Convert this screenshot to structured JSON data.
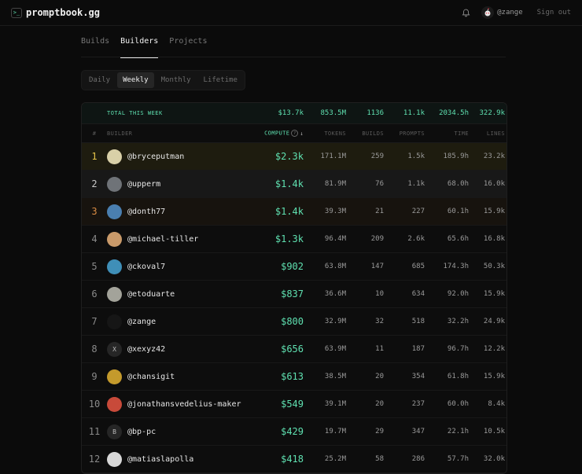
{
  "app": {
    "logo_glyph": ">_",
    "brand": "promptbook.gg",
    "username": "@zange",
    "sign_out": "Sign out"
  },
  "tabs": [
    {
      "label": "Builds",
      "active": false
    },
    {
      "label": "Builders",
      "active": true
    },
    {
      "label": "Projects",
      "active": false
    }
  ],
  "periods": [
    {
      "label": "Daily",
      "active": false
    },
    {
      "label": "Weekly",
      "active": true
    },
    {
      "label": "Monthly",
      "active": false
    },
    {
      "label": "Lifetime",
      "active": false
    }
  ],
  "totals": {
    "label": "TOTAL THIS WEEK",
    "compute": "$13.7k",
    "tokens": "853.5M",
    "builds": "1136",
    "prompts": "11.1k",
    "time": "2034.5h",
    "lines": "322.9k"
  },
  "columns": {
    "rank": "#",
    "builder": "BUILDER",
    "compute": "COMPUTE",
    "tokens": "TOKENS",
    "builds": "BUILDS",
    "prompts": "PROMPTS",
    "time": "TIME",
    "lines": "LINES",
    "sort_arrow": "↓"
  },
  "colors": {
    "accent": "#5fe0b0",
    "gold": "#e6c54a",
    "silver": "#c9c9c9",
    "bronze": "#d98c43"
  },
  "rows": [
    {
      "rank": "1",
      "handle": "@bryceputman",
      "compute": "$2.3k",
      "tokens": "171.1M",
      "builds": "259",
      "prompts": "1.5k",
      "time": "185.9h",
      "lines": "23.2k",
      "avatar": "",
      "avatar_color": "#d9d0a8"
    },
    {
      "rank": "2",
      "handle": "@upperm",
      "compute": "$1.4k",
      "tokens": "81.9M",
      "builds": "76",
      "prompts": "1.1k",
      "time": "68.0h",
      "lines": "16.0k",
      "avatar": "",
      "avatar_color": "#6f7378"
    },
    {
      "rank": "3",
      "handle": "@donth77",
      "compute": "$1.4k",
      "tokens": "39.3M",
      "builds": "21",
      "prompts": "227",
      "time": "60.1h",
      "lines": "15.9k",
      "avatar": "",
      "avatar_color": "#4a7fb0"
    },
    {
      "rank": "4",
      "handle": "@michael-tiller",
      "compute": "$1.3k",
      "tokens": "96.4M",
      "builds": "209",
      "prompts": "2.6k",
      "time": "65.6h",
      "lines": "16.8k",
      "avatar": "",
      "avatar_color": "#c99a6a"
    },
    {
      "rank": "5",
      "handle": "@ckoval7",
      "compute": "$902",
      "tokens": "63.8M",
      "builds": "147",
      "prompts": "685",
      "time": "174.3h",
      "lines": "50.3k",
      "avatar": "",
      "avatar_color": "#3f8fb8"
    },
    {
      "rank": "6",
      "handle": "@etoduarte",
      "compute": "$837",
      "tokens": "36.6M",
      "builds": "10",
      "prompts": "634",
      "time": "92.0h",
      "lines": "15.9k",
      "avatar": "",
      "avatar_color": "#a3a39a"
    },
    {
      "rank": "7",
      "handle": "@zange",
      "compute": "$800",
      "tokens": "32.9M",
      "builds": "32",
      "prompts": "518",
      "time": "32.2h",
      "lines": "24.9k",
      "avatar": "",
      "avatar_color": "#161616"
    },
    {
      "rank": "8",
      "handle": "@xexyz42",
      "compute": "$656",
      "tokens": "63.9M",
      "builds": "11",
      "prompts": "187",
      "time": "96.7h",
      "lines": "12.2k",
      "avatar": "X",
      "avatar_color": "#262626"
    },
    {
      "rank": "9",
      "handle": "@chansigit",
      "compute": "$613",
      "tokens": "38.5M",
      "builds": "20",
      "prompts": "354",
      "time": "61.8h",
      "lines": "15.9k",
      "avatar": "",
      "avatar_color": "#c49a2c"
    },
    {
      "rank": "10",
      "handle": "@jonathansvedelius-maker",
      "compute": "$549",
      "tokens": "39.1M",
      "builds": "20",
      "prompts": "237",
      "time": "60.0h",
      "lines": "8.4k",
      "avatar": "",
      "avatar_color": "#c84a3a"
    },
    {
      "rank": "11",
      "handle": "@bp-pc",
      "compute": "$429",
      "tokens": "19.7M",
      "builds": "29",
      "prompts": "347",
      "time": "22.1h",
      "lines": "10.5k",
      "avatar": "B",
      "avatar_color": "#262626"
    },
    {
      "rank": "12",
      "handle": "@matiaslapolla",
      "compute": "$418",
      "tokens": "25.2M",
      "builds": "58",
      "prompts": "286",
      "time": "57.7h",
      "lines": "32.0k",
      "avatar": "",
      "avatar_color": "#d8d8d8"
    }
  ]
}
